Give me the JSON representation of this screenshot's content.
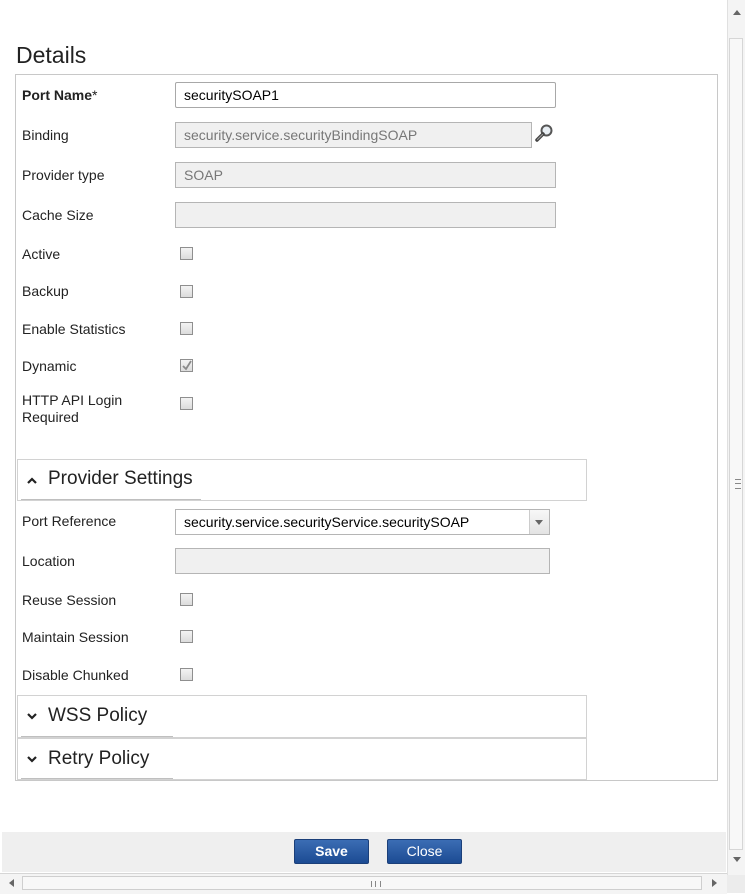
{
  "page": {
    "title": "Details"
  },
  "fields": {
    "port_name": {
      "label": "Port Name",
      "required_mark": "*",
      "value": "securitySOAP1"
    },
    "binding": {
      "label": "Binding",
      "value": "security.service.securityBindingSOAP"
    },
    "provider_type": {
      "label": "Provider type",
      "value": "SOAP"
    },
    "cache_size": {
      "label": "Cache Size",
      "value": ""
    },
    "active": {
      "label": "Active",
      "checked": false
    },
    "backup": {
      "label": "Backup",
      "checked": false
    },
    "enable_statistics": {
      "label": "Enable Statistics",
      "checked": false
    },
    "dynamic": {
      "label": "Dynamic",
      "checked": true
    },
    "http_api_login": {
      "label_line1": "HTTP API Login",
      "label_line2": "Required",
      "checked": false
    }
  },
  "provider_settings": {
    "title": "Provider Settings",
    "expanded": true,
    "port_reference": {
      "label": "Port Reference",
      "selected": "security.service.securityService.securitySOAP"
    },
    "location": {
      "label": "Location",
      "value": ""
    },
    "reuse_session": {
      "label": "Reuse Session",
      "checked": false
    },
    "maintain_session": {
      "label": "Maintain Session",
      "checked": false
    },
    "disable_chunked": {
      "label": "Disable Chunked",
      "checked": false
    }
  },
  "wss_policy": {
    "title": "WSS Policy",
    "expanded": false
  },
  "retry_policy": {
    "title": "Retry Policy",
    "expanded": false
  },
  "footer": {
    "save_label": "Save",
    "close_label": "Close"
  },
  "icons": {
    "binding_lookup": "magnifier-icon",
    "collapse": "chevron-up-icon",
    "expand": "chevron-down-icon"
  },
  "colors": {
    "button_blue": "#2a5aa3",
    "border": "#c8c8c8"
  }
}
